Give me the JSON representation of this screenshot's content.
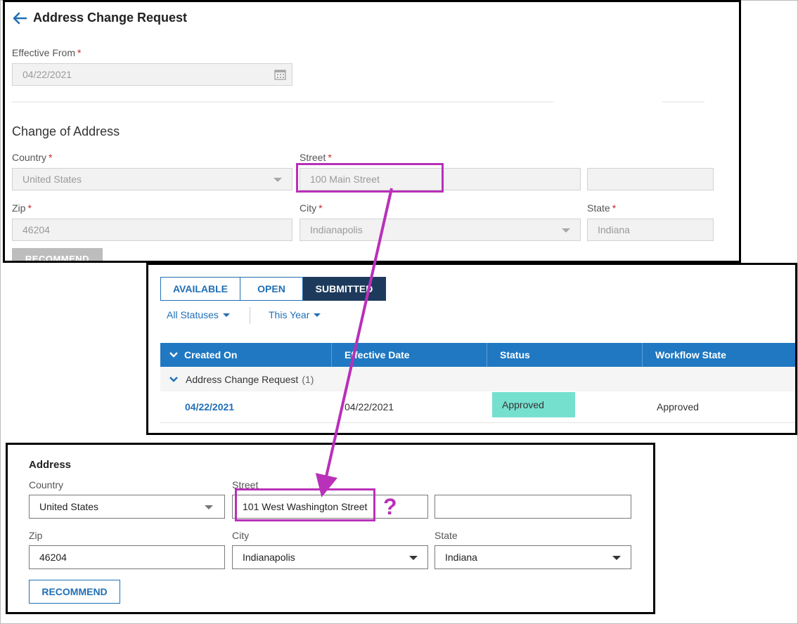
{
  "panel1": {
    "title": "Address Change Request",
    "effective_from_label": "Effective From",
    "required_mark": "*",
    "effective_from_value": "04/22/2021",
    "section_title": "Change of Address",
    "country_label": "Country",
    "country_value": "United States",
    "street_label": "Street",
    "street_value": "100 Main Street",
    "street2_value": "",
    "zip_label": "Zip",
    "zip_value": "46204",
    "city_label": "City",
    "city_value": "Indianapolis",
    "state_label": "State",
    "state_value": "Indiana",
    "recommend_label": "RECOMMEND"
  },
  "panel2": {
    "tabs": [
      {
        "label": "AVAILABLE",
        "active": false
      },
      {
        "label": "OPEN",
        "active": false
      },
      {
        "label": "SUBMITTED",
        "active": true
      }
    ],
    "filters": [
      "All Statuses",
      "This Year"
    ],
    "columns": [
      "Created On",
      "Effective Date",
      "Status",
      "Workflow State"
    ],
    "group": {
      "label": "Address Change Request",
      "count": "(1)"
    },
    "rows": [
      {
        "created_on": "04/22/2021",
        "effective_date": "04/22/2021",
        "status": "Approved",
        "workflow_state": "Approved"
      }
    ]
  },
  "panel3": {
    "title": "Address",
    "country_label": "Country",
    "country_value": "United States",
    "street_label": "Street",
    "street_value": "101 West Washington Street",
    "street2_value": "",
    "zip_label": "Zip",
    "zip_value": "46204",
    "city_label": "City",
    "city_value": "Indianapolis",
    "state_label": "State",
    "state_value": "Indiana",
    "recommend_label": "RECOMMEND"
  },
  "annotation": {
    "question_mark": "?",
    "color": "#b930b9"
  },
  "colors": {
    "primary_blue": "#1f78c1",
    "link_blue": "#1f6fb6",
    "active_tab": "#1d3a5c",
    "approved_chip": "#76e0cf",
    "required_red": "#c62828"
  }
}
